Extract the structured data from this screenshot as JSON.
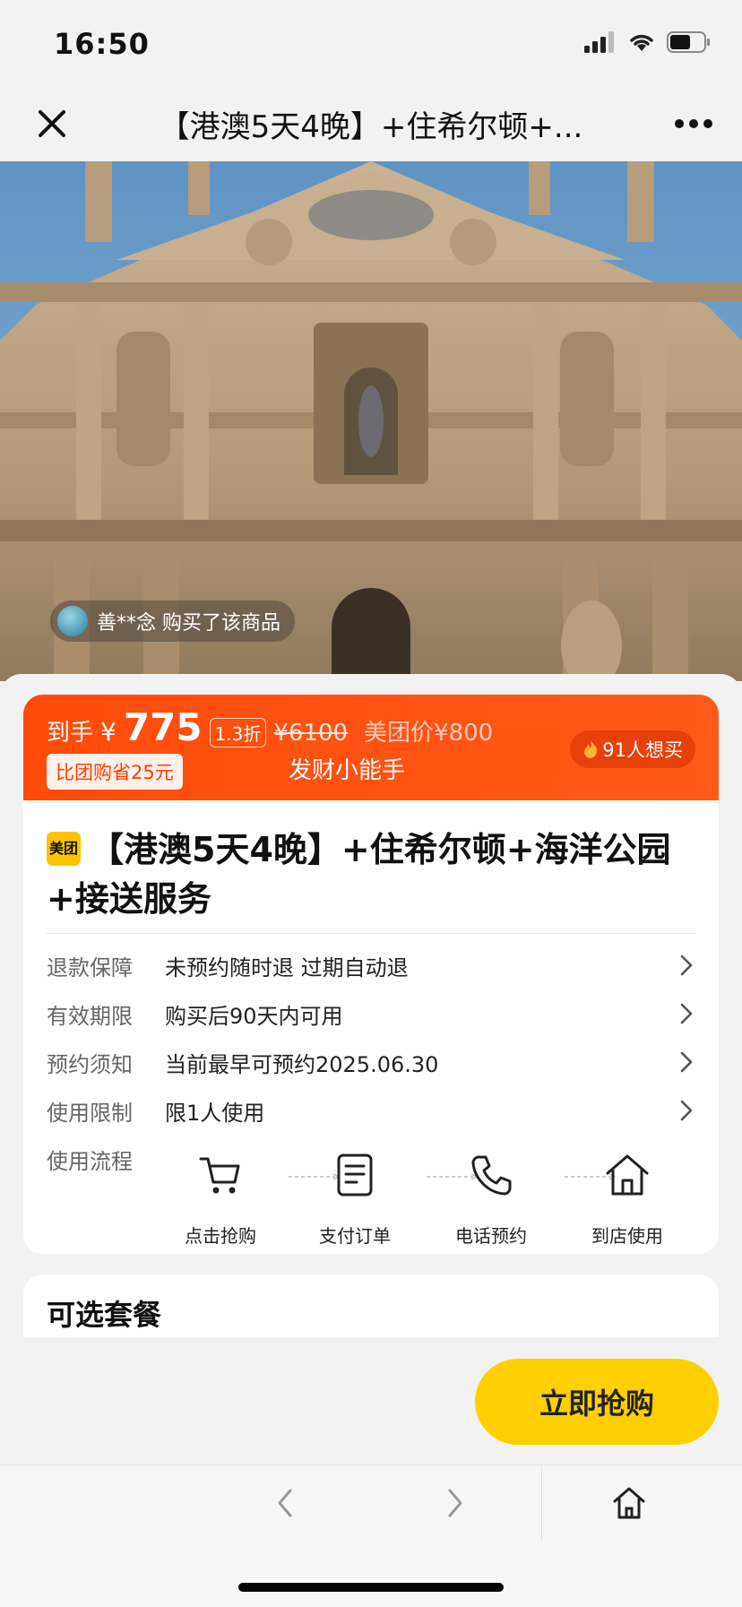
{
  "status_bar": {
    "time": "16:50"
  },
  "nav": {
    "title": "【港澳5天4晚】+住希尔顿+..."
  },
  "hero": {
    "buyer_notice": "善**念 购买了该商品"
  },
  "price_banner": {
    "daoshou_label": "到手",
    "currency": "¥",
    "price": "775",
    "discount": "1.3折",
    "original_price": "¥6100",
    "meituan_price": "美团价¥800",
    "save_badge": "比团购省25元",
    "seller": "发财小能手",
    "want_count": "91人想买",
    "color": "#ff4b0a"
  },
  "product": {
    "logo_text": "美团",
    "title": "【港澳5天4晚】+住希尔顿+海洋公园+接送服务"
  },
  "details": [
    {
      "label": "退款保障",
      "value": "未预约随时退 过期自动退"
    },
    {
      "label": "有效期限",
      "value": "购买后90天内可用"
    },
    {
      "label": "预约须知",
      "value": "当前最早可预约2025.06.30"
    },
    {
      "label": "使用限制",
      "value": "限1人使用"
    }
  ],
  "flow": {
    "label": "使用流程",
    "steps": [
      {
        "label": "点击抢购",
        "icon": "cart-icon"
      },
      {
        "label": "支付订单",
        "icon": "document-icon"
      },
      {
        "label": "电话预约",
        "icon": "phone-icon"
      },
      {
        "label": "到店使用",
        "icon": "home-icon"
      }
    ]
  },
  "packages": {
    "title": "可选套餐"
  },
  "buy_button": {
    "label": "立即抢购",
    "color": "#ffd000"
  }
}
